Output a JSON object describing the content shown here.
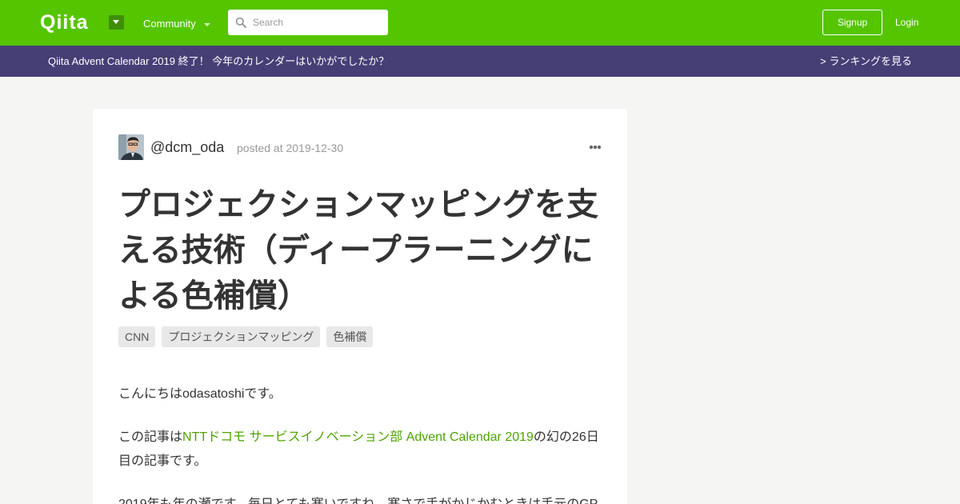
{
  "header": {
    "logo_text": "Qiita",
    "community_label": "Community",
    "search_placeholder": "Search",
    "signup_label": "Signup",
    "login_label": "Login",
    "brand_color": "#55c500"
  },
  "banner": {
    "text": "Qiita Advent Calendar 2019 終了！ 今年のカレンダーはいかがでしたか？",
    "link_label": "> ランキングを見る",
    "color": "#463f76"
  },
  "article": {
    "author": "@dcm_oda",
    "posted": "posted at 2019-12-30",
    "title": "プロジェクションマッピングを支える技術（ディープラーニングによる色補償）",
    "tags": [
      "CNN",
      "プロジェクションマッピング",
      "色補償"
    ],
    "p1": "こんにちはodasatoshiです。",
    "p2_before": "この記事は",
    "p2_link": "NTTドコモ サービスイノベーション部 Advent Calendar 2019",
    "p2_after": "の幻の26日目の記事です。",
    "p3": "2019年も年の瀬です。毎日とても寒いですね。寒さで手がかじかむときは手元のGP",
    "link_color": "#4fa400"
  }
}
